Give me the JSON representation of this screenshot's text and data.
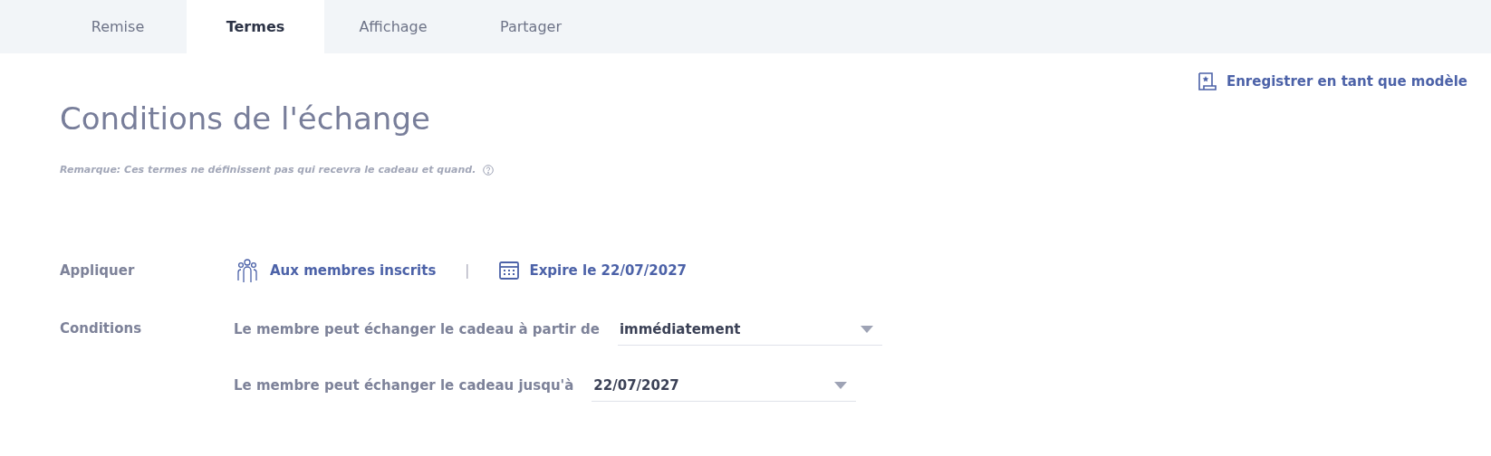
{
  "tabs": [
    {
      "label": "Remise",
      "selected": false
    },
    {
      "label": "Termes",
      "selected": true
    },
    {
      "label": "Affichage",
      "selected": false
    },
    {
      "label": "Partager",
      "selected": false
    }
  ],
  "save_template": {
    "label": "Enregistrer en tant que modèle"
  },
  "heading": "Conditions de l'échange",
  "note": "Remarque: Ces termes ne définissent pas qui recevra le cadeau et quand.",
  "apply": {
    "label": "Appliquer",
    "members": "Aux membres inscrits",
    "separator": "|",
    "expiry": "Expire le 22/07/2027"
  },
  "conditions": {
    "label": "Conditions",
    "rows": [
      {
        "text": "Le membre peut échanger le cadeau à partir de",
        "value": "immédiatement"
      },
      {
        "text": "Le membre peut échanger le cadeau jusqu'à",
        "value": "22/07/2027"
      }
    ]
  }
}
